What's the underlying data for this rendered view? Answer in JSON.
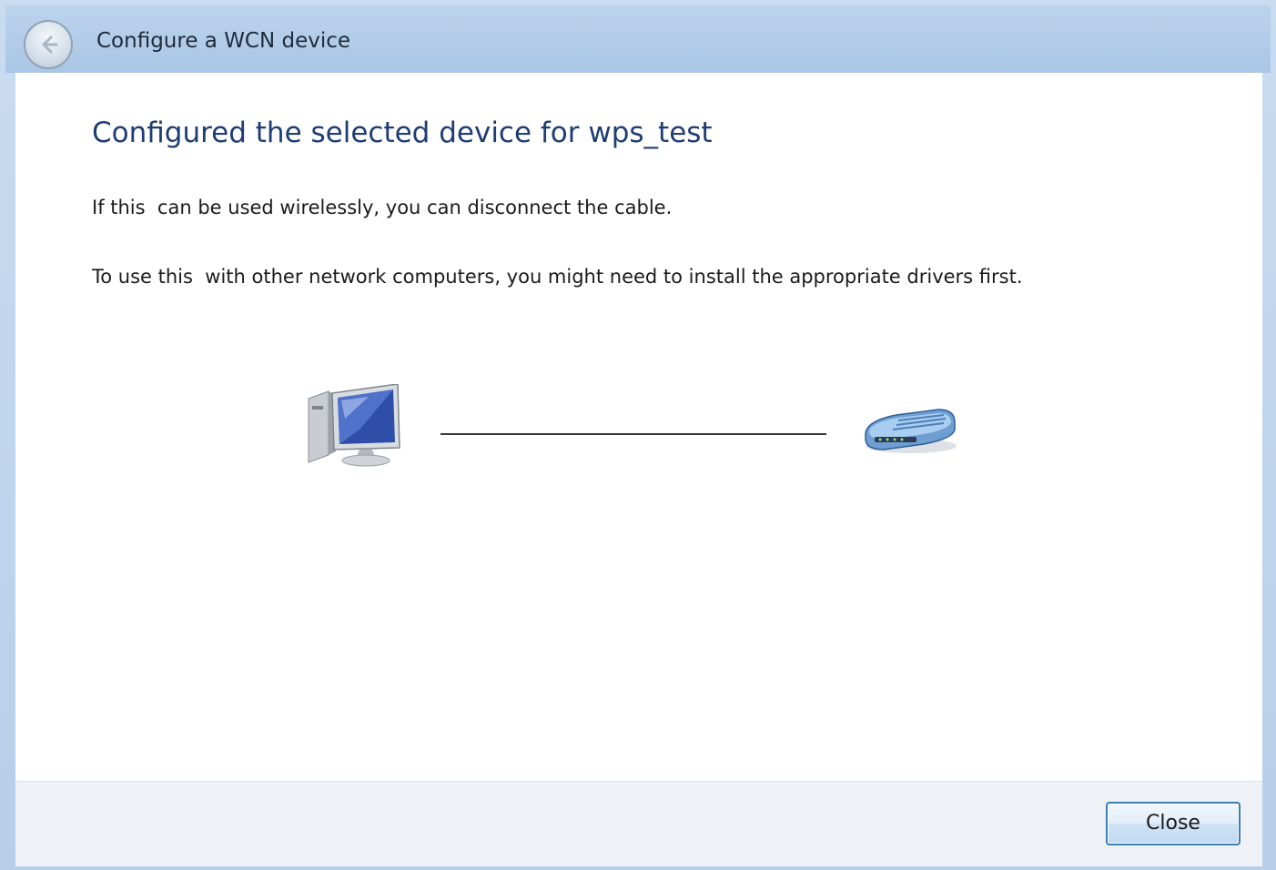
{
  "window": {
    "title": "Configure a WCN device"
  },
  "main": {
    "heading": "Configured the selected device for wps_test",
    "paragraph1": "If this  can be used wirelessly, you can disconnect the cable.",
    "paragraph2": "To use this  with other network computers, you might need to install the appropriate drivers first."
  },
  "illustration": {
    "left_icon": "computer-icon",
    "right_icon": "router-icon"
  },
  "footer": {
    "close_label": "Close"
  },
  "colors": {
    "titlebar": "#aac6e6",
    "heading": "#1f3d74",
    "footer_bg": "#eef1f5",
    "button_border": "#3c7fb1"
  }
}
